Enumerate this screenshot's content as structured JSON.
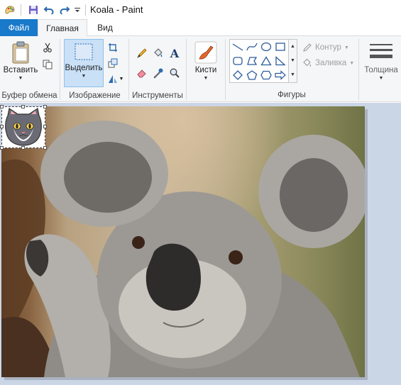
{
  "window": {
    "title": "Koala - Paint"
  },
  "quick_access": {
    "icons": [
      "paint-app-icon",
      "save-icon",
      "undo-icon",
      "redo-icon",
      "customize-dropdown-icon"
    ]
  },
  "tabs": [
    {
      "label": "Файл",
      "active": false
    },
    {
      "label": "Главная",
      "active": true
    },
    {
      "label": "Вид",
      "active": false
    }
  ],
  "ribbon": {
    "clipboard": {
      "paste_label": "Вставить",
      "group_label": "Буфер обмена"
    },
    "image": {
      "select_label": "Выделить",
      "group_label": "Изображение"
    },
    "tools": {
      "group_label": "Инструменты"
    },
    "brushes": {
      "label": "Кисти"
    },
    "shapes": {
      "outline_label": "Контур",
      "fill_label": "Заливка",
      "group_label": "Фигуры"
    },
    "size": {
      "label": "Толщина"
    }
  },
  "colors": {
    "file_tab": "#1979ca",
    "ribbon_bg": "#f5f6f7",
    "workspace_bg": "#cad5e5",
    "selection_highlight": "#c9e0f7"
  }
}
